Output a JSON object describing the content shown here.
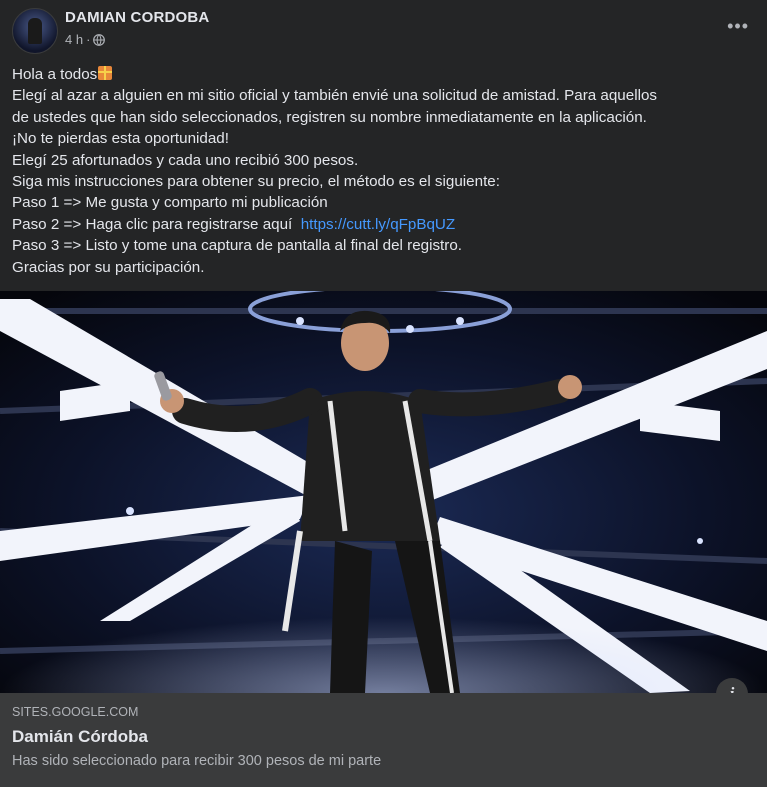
{
  "post": {
    "author": "DAMIAN CORDOBA",
    "time": "4 h",
    "separator": "·",
    "privacy_icon": "globe-icon",
    "more_icon": "more-horizontal-icon",
    "more_label": "•••",
    "lines": [
      "Hola a todos",
      "Elegí al azar a alguien en mi sitio oficial y también envié una solicitud de amistad. Para aquellos",
      "de ustedes que han sido seleccionados, registren su nombre inmediatamente en la aplicación.",
      "¡No te pierdas esta oportunidad!",
      "Elegí 25 afortunados y cada uno recibió 300 pesos.",
      "Siga mis instrucciones para obtener su precio, el método es el siguiente:",
      "Paso 1 => Me gusta y comparto mi publicación",
      "Paso 2 => Haga clic para registrarse aquí  ",
      "Paso 3 => Listo y tome una captura de pantalla al final del registro.",
      "Gracias por su participación."
    ],
    "link": "https://cutt.ly/qFpBqUZ",
    "emoji_icon": "gift-icon"
  },
  "link_preview": {
    "domain": "SITES.GOOGLE.COM",
    "title": "Damián Córdoba",
    "description": "Has sido seleccionado para recibir 300 pesos de mi parte",
    "info_icon": "info-icon",
    "info_label": "i"
  },
  "photo": {
    "description_icon": "concert-photo"
  }
}
